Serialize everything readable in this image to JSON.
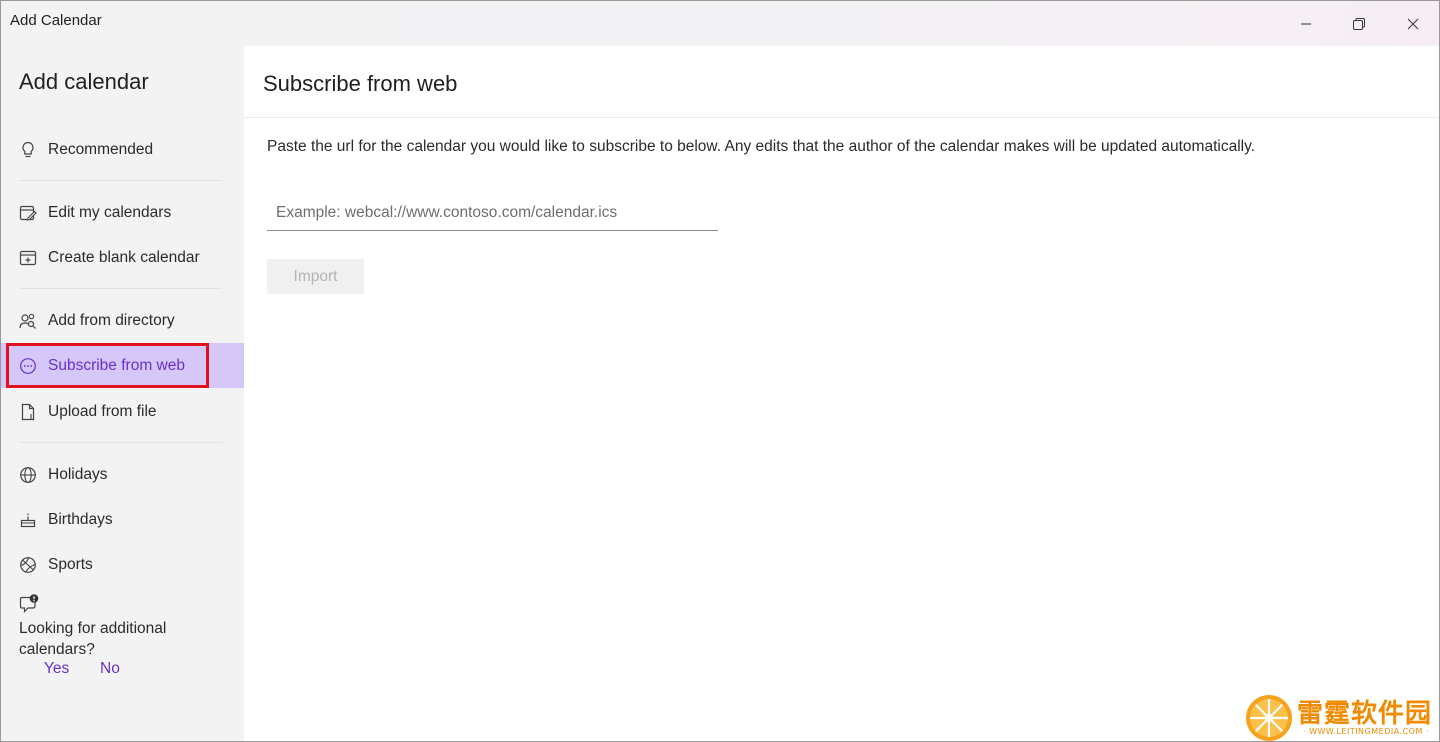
{
  "window": {
    "title": "Add Calendar"
  },
  "sidebar": {
    "heading": "Add calendar",
    "items": [
      {
        "label": "Recommended",
        "icon": "lightbulb-icon"
      },
      {
        "label": "Edit my calendars",
        "icon": "edit-calendar-icon"
      },
      {
        "label": "Create blank calendar",
        "icon": "calendar-add-icon"
      },
      {
        "label": "Add from directory",
        "icon": "people-search-icon"
      },
      {
        "label": "Subscribe from web",
        "icon": "web-subscribe-icon",
        "selected": true
      },
      {
        "label": "Upload from file",
        "icon": "document-icon"
      },
      {
        "label": "Holidays",
        "icon": "globe-icon"
      },
      {
        "label": "Birthdays",
        "icon": "cake-icon"
      },
      {
        "label": "Sports",
        "icon": "ball-icon"
      }
    ],
    "feedback": {
      "question": "Looking for additional calendars?",
      "yes": "Yes",
      "no": "No"
    }
  },
  "main": {
    "title": "Subscribe from web",
    "description": "Paste the url for the calendar you would like to subscribe to below. Any edits that the author of the calendar makes will be updated automatically.",
    "url_input": {
      "placeholder": "Example: webcal://www.contoso.com/calendar.ics",
      "value": ""
    },
    "import_label": "Import"
  },
  "watermark": {
    "text": "雷霆软件园",
    "sub": "· WWW.LEITINGMEDIA.COM ·"
  },
  "colors": {
    "accent": "#6b2fc9",
    "selected_bg": "#d5c7f7",
    "highlight_border": "#e0121d",
    "sidebar_bg": "#f3f3f3"
  }
}
